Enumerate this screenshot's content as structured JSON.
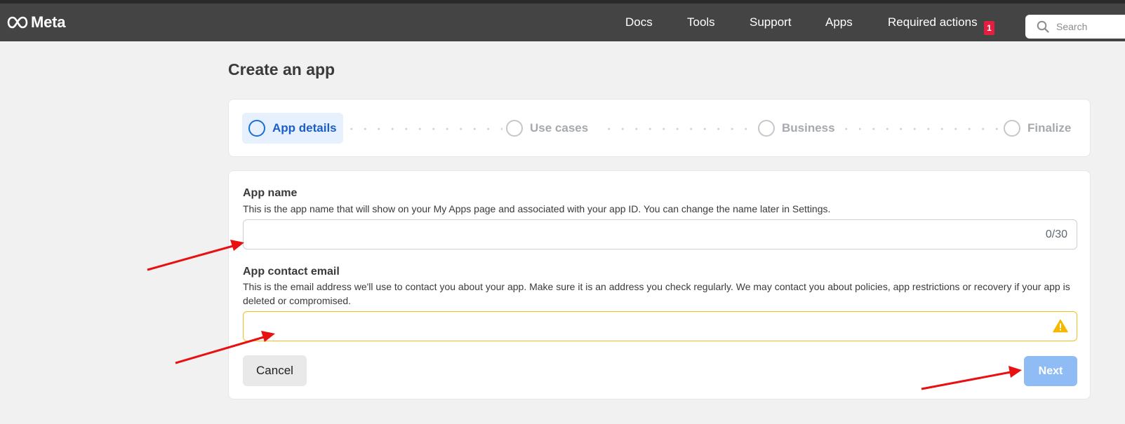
{
  "brand": {
    "name": "Meta"
  },
  "nav": {
    "links": [
      "Docs",
      "Tools",
      "Support",
      "Apps",
      "Required actions"
    ],
    "badge_count": "1",
    "search_placeholder": "Search"
  },
  "page": {
    "title": "Create an app"
  },
  "steps": [
    {
      "label": "App details",
      "active": true
    },
    {
      "label": "Use cases",
      "active": false
    },
    {
      "label": "Business",
      "active": false
    },
    {
      "label": "Finalize",
      "active": false
    }
  ],
  "form": {
    "app_name": {
      "label": "App name",
      "help": "This is the app name that will show on your My Apps page and associated with your app ID. You can change the name later in Settings.",
      "value": "",
      "counter": "0/30"
    },
    "contact_email": {
      "label": "App contact email",
      "help": "This is the email address we'll use to contact you about your app. Make sure it is an address you check regularly. We may contact you about policies, app restrictions or recovery if your app is deleted or compromised.",
      "value": ""
    },
    "cancel_label": "Cancel",
    "next_label": "Next"
  },
  "colors": {
    "navbar": "#444444",
    "active_step": "#1a5fc8",
    "warning": "#f2c01e",
    "next_disabled": "#8fbcf5",
    "annotation_arrow": "#e81010"
  }
}
